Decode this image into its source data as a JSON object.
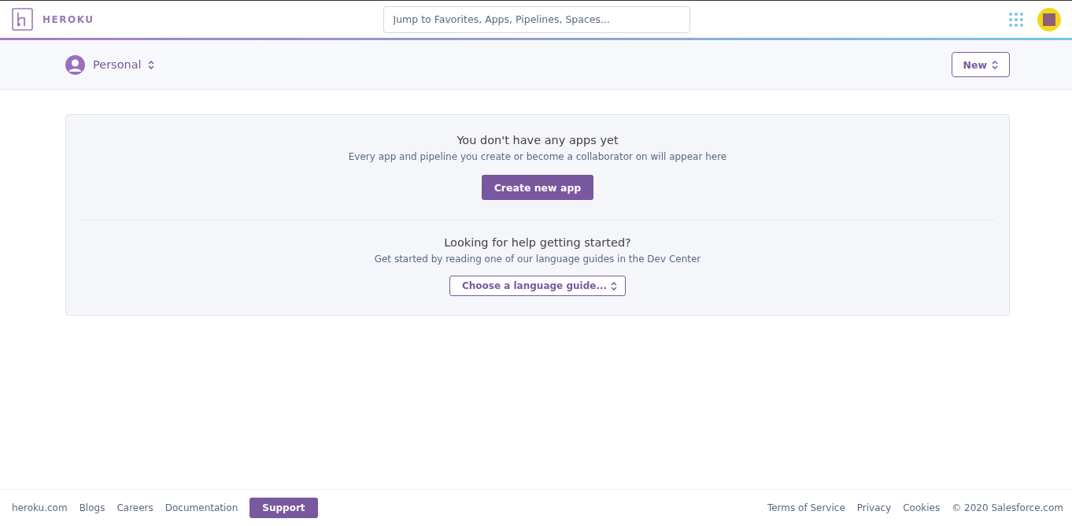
{
  "header": {
    "brand": "HEROKU",
    "search": {
      "placeholder": "Jump to Favorites, Apps, Pipelines, Spaces..."
    }
  },
  "subheader": {
    "account": "Personal",
    "new_button": "New"
  },
  "empty_state": {
    "title": "You don't have any apps yet",
    "text": "Every app and pipeline you create or become a collaborator on will appear here",
    "button": "Create new app"
  },
  "help": {
    "title": "Looking for help getting started?",
    "text": "Get started by reading one of our language guides in the Dev Center",
    "select": "Choose a language guide..."
  },
  "footer": {
    "links": [
      {
        "label": "heroku.com",
        "kind": "link"
      },
      {
        "label": "Blogs",
        "kind": "link"
      },
      {
        "label": "Careers",
        "kind": "link"
      },
      {
        "label": "Documentation",
        "kind": "link"
      },
      {
        "label": "Support",
        "kind": "button"
      }
    ],
    "right_links": [
      "Terms of Service",
      "Privacy",
      "Cookies"
    ],
    "copyright": "© 2020 Salesforce.com"
  }
}
